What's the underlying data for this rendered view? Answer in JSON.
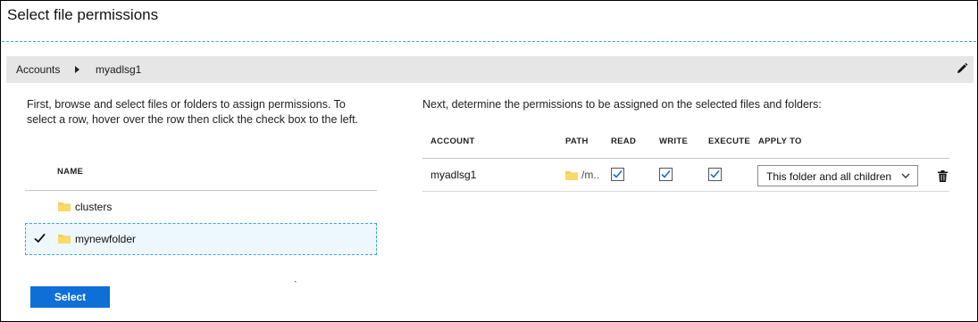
{
  "title": "Select file permissions",
  "breadcrumb": {
    "root": "Accounts",
    "current": "myadlsg1"
  },
  "left_panel": {
    "intro": "First, browse and select files or folders to assign permissions. To select a row, hover over the row then click the check box to the left.",
    "column_header": "NAME",
    "rows": [
      {
        "label": "clusters",
        "icon": "folder-icon",
        "selected": false
      },
      {
        "label": "mynewfolder",
        "icon": "folder-icon",
        "selected": true
      }
    ],
    "select_button": "Select"
  },
  "right_panel": {
    "intro": "Next, determine the permissions to be assigned on the selected files and folders:",
    "headers": {
      "account": "ACCOUNT",
      "path": "PATH",
      "read": "READ",
      "write": "WRITE",
      "execute": "EXECUTE",
      "apply_to": "APPLY TO"
    },
    "row": {
      "account": "myadlsg1",
      "path": "/m..",
      "read": true,
      "write": true,
      "execute": true,
      "apply_to": "This folder and all children"
    }
  },
  "icons": [
    "edit-icon",
    "chevron-right-icon",
    "folder-icon",
    "check-icon",
    "chevron-down-icon",
    "trash-icon"
  ],
  "colors": {
    "accent": "#0f6fd8",
    "selection_border": "#3aa6d9",
    "selection_fill": "#eef7fb",
    "breadcrumb_bg": "#e6e6e6",
    "folder": "#f5cd57"
  }
}
